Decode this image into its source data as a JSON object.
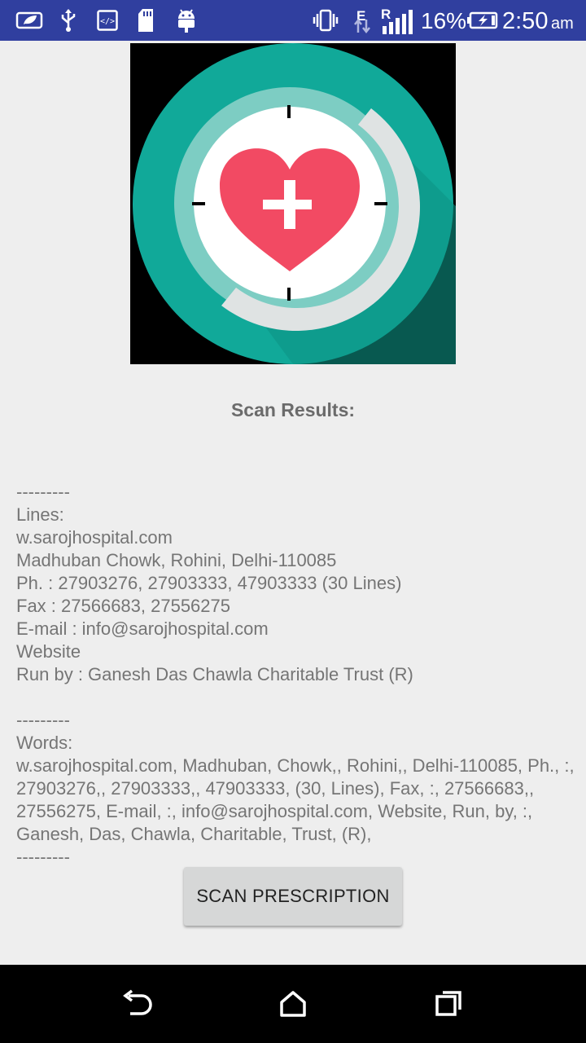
{
  "status_bar": {
    "network_e": "E",
    "network_r": "R",
    "battery_percent": "16%",
    "time": "2:50",
    "time_suffix": "am",
    "icons": [
      "leaf-notification-icon",
      "usb-icon",
      "developer-icon",
      "sd-card-icon",
      "android-icon",
      "vibrate-icon",
      "data-arrows-icon",
      "signal-icon",
      "battery-charging-icon"
    ]
  },
  "scan_title": "Scan Results:",
  "results_text": "---------\nLines:\nw.sarojhospital.com\nMadhuban Chowk, Rohini, Delhi-110085\nPh. : 27903276, 27903333, 47903333 (30 Lines)\nFax : 27566683, 27556275\nE-mail : info@sarojhospital.com\nWebsite\nRun by : Ganesh Das Chawla Charitable Trust (R)\n\n---------\nWords:\nw.sarojhospital.com, Madhuban, Chowk,, Rohini,, Delhi-110085, Ph., :, 27903276,, 27903333,, 47903333, (30, Lines), Fax, :, 27566683,, 27556275, E-mail, :, info@sarojhospital.com, Website, Run, by, :, Ganesh, Das, Chawla, Charitable, Trust, (R),\n---------",
  "scan_button_label": "SCAN PRESCRIPTION",
  "nav": {
    "icons": [
      "back-icon",
      "home-icon",
      "recents-icon"
    ]
  },
  "colors": {
    "status_bar": "#303f9f",
    "background": "#eeeeee",
    "logo_teal": "#11a999",
    "heart": "#f24a63",
    "button": "#d6d7d7"
  }
}
